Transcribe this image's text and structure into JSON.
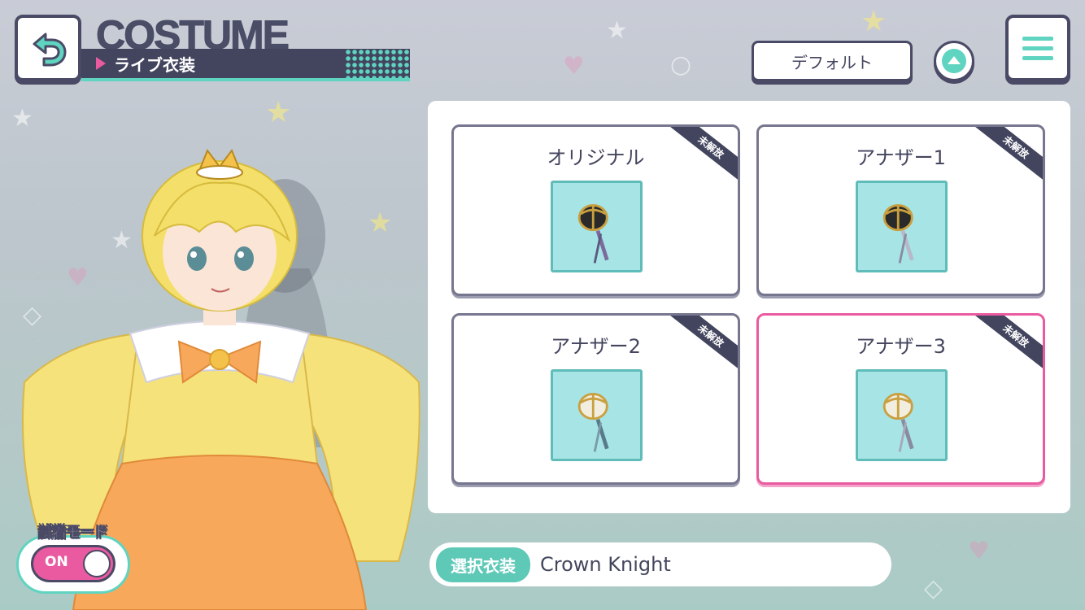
{
  "header": {
    "title": "COSTUME",
    "subtitle": "ライブ衣装"
  },
  "controls": {
    "default_label": "デフォルト"
  },
  "costumes": [
    {
      "name": "オリジナル",
      "badge": "未解放",
      "variant": "dark"
    },
    {
      "name": "アナザー1",
      "badge": "未解放",
      "variant": "dark"
    },
    {
      "name": "アナザー2",
      "badge": "未解放",
      "variant": "light"
    },
    {
      "name": "アナザー3",
      "badge": "未解放",
      "variant": "light"
    }
  ],
  "try_on": {
    "label": "試着モード",
    "state": "ON"
  },
  "selected": {
    "tag": "選択衣装",
    "value": "Crown Knight"
  },
  "colors": {
    "accent_teal": "#5fd4c0",
    "accent_pink": "#ea5aa0",
    "dark_navy": "#43455f"
  }
}
